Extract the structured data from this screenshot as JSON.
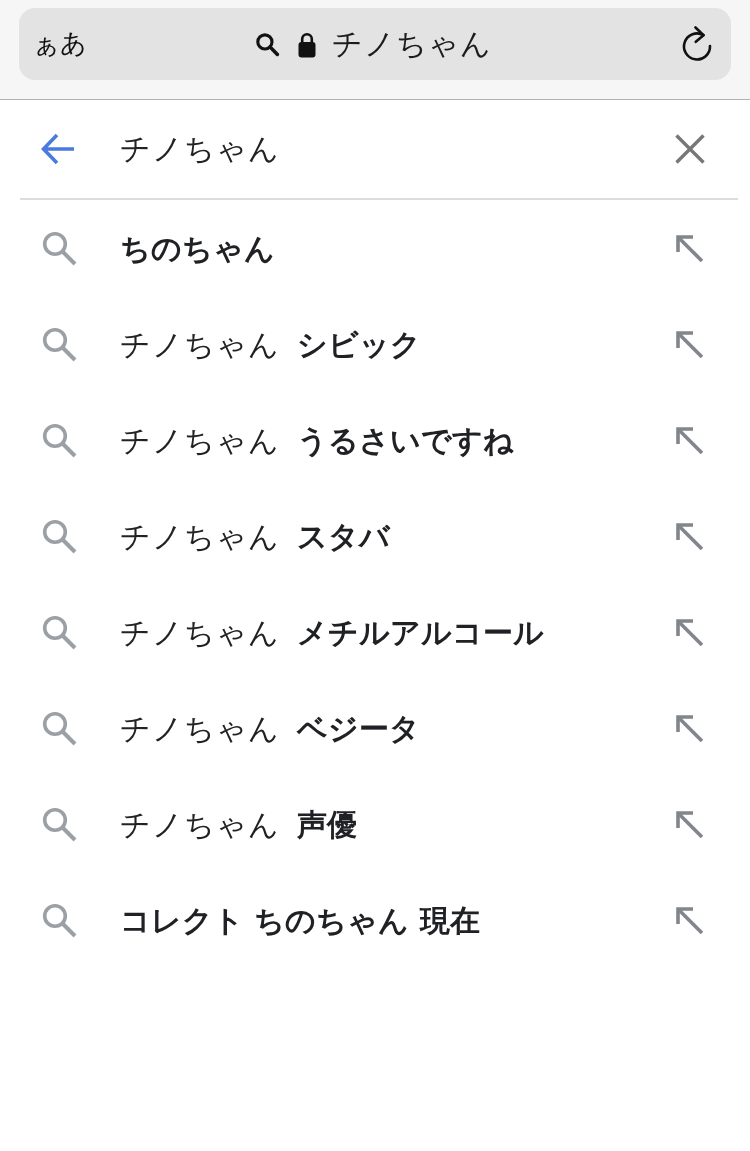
{
  "browser_bar": {
    "text_size_button": "ぁあ",
    "address": "チノちゃん"
  },
  "search_box": {
    "value": "チノちゃん"
  },
  "suggestions": [
    {
      "completion": "ちのちゃん"
    },
    {
      "prefix": "チノちゃん",
      "completion": "シビック"
    },
    {
      "prefix": "チノちゃん",
      "completion": "うるさいですね"
    },
    {
      "prefix": "チノちゃん",
      "completion": "スタバ"
    },
    {
      "prefix": "チノちゃん",
      "completion": "メチルアルコール"
    },
    {
      "prefix": "チノちゃん",
      "completion": "ベジータ"
    },
    {
      "prefix": "チノちゃん",
      "completion": "声優"
    },
    {
      "completion": "コレクト ちのちゃん 現在"
    }
  ]
}
